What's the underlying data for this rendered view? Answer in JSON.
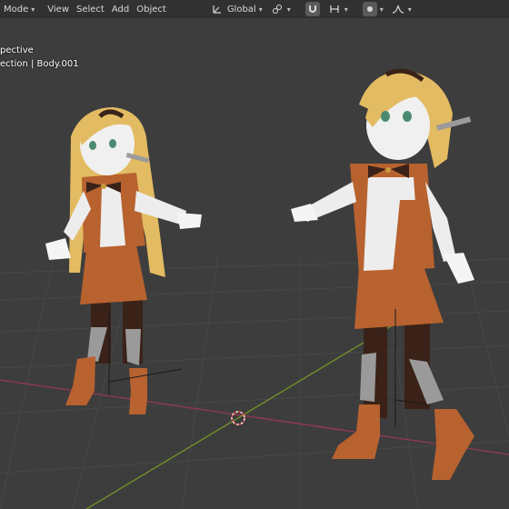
{
  "header": {
    "mode_label": "Mode",
    "menus": [
      "View",
      "Select",
      "Add",
      "Object"
    ],
    "transform_orientation": "Global"
  },
  "icons": {
    "orientation": "orientation-axes-icon",
    "snap_link": "link-icon",
    "snap_magnet": "magnet-icon",
    "snap_target": "snap-increment-icon",
    "proportional": "proportional-edit-icon",
    "falloff": "falloff-curve-icon"
  },
  "viewport": {
    "view_name": "pective",
    "collection_line": "ection | Body.001"
  },
  "colors": {
    "background": "#3d3d3d",
    "grid": "#4a4a4a",
    "x_axis": "#8a3a50",
    "y_axis": "#6e8a2a",
    "outfit": "#b8622f",
    "hair": "#e3bb62",
    "skin": "#f0f0f0"
  }
}
